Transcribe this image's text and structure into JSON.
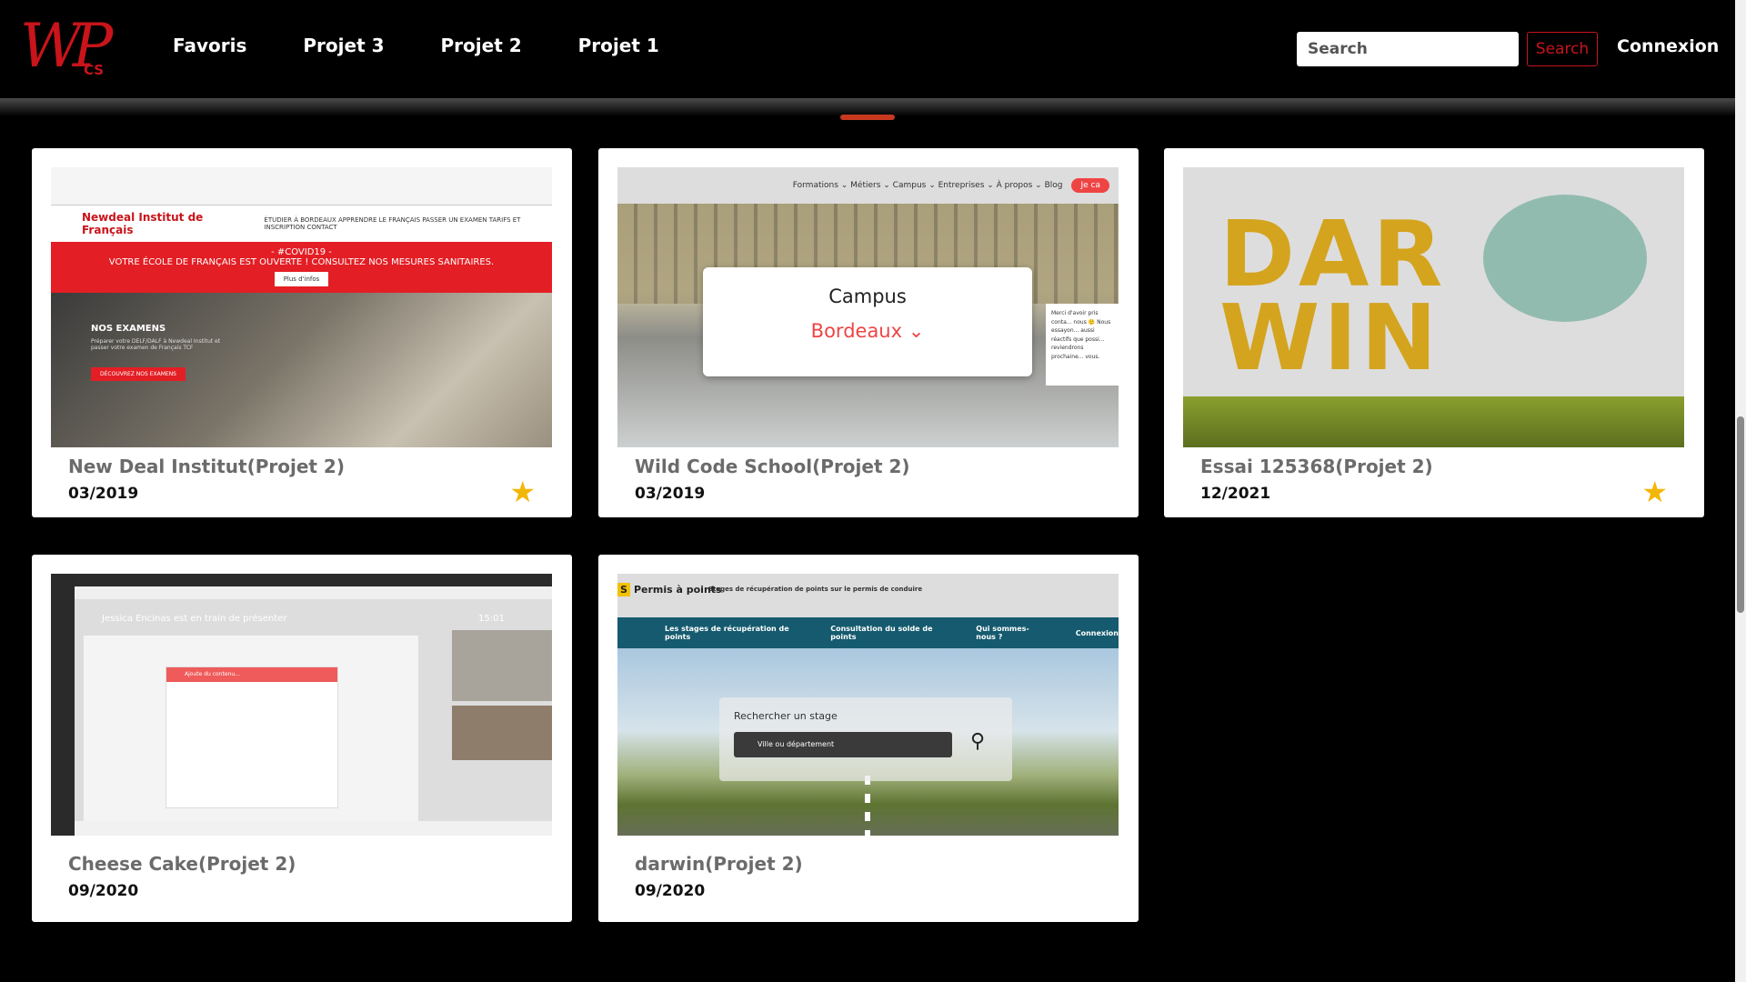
{
  "brand": {
    "logo_main": "WP",
    "logo_sub": "CS"
  },
  "nav": {
    "items": [
      "Favoris",
      "Projet 3",
      "Projet 2",
      "Projet 1"
    ]
  },
  "search": {
    "placeholder": "Search",
    "button_label": "Search"
  },
  "login_label": "Connexion",
  "colors": {
    "accent": "#c8141a",
    "star": "#f2b705",
    "card_bg": "#ffffff",
    "page_bg": "#000000"
  },
  "projects": [
    {
      "title": "New Deal Institut(Projet 2)",
      "date": "03/2019",
      "favorite": true,
      "thumb": {
        "brand": "Newdeal Institut de Français",
        "menu": "ÉTUDIER À BORDEAUX   APPRENDRE LE FRANÇAIS   PASSER UN EXAMEN   TARIFS ET INSCRIPTION   CONTACT",
        "banner_title": "- #COVID19 -",
        "banner_text": "VOTRE ÉCOLE DE FRANÇAIS EST OUVERTE ! CONSULTEZ NOS MESURES SANITAIRES.",
        "banner_button": "Plus d'infos",
        "section_title": "NOS EXAMENS",
        "section_text": "Préparer votre DELF/DALF à Newdeal Institut et passer votre examen de Français TCF",
        "section_button": "DÉCOUVREZ NOS EXAMENS"
      }
    },
    {
      "title": "Wild Code School(Projet 2)",
      "date": "03/2019",
      "favorite": false,
      "thumb": {
        "menu": "Formations ⌄   Métiers ⌄   Campus ⌄   Entreprises ⌄   À propos ⌄   Blog",
        "cta": "Je ca",
        "box_title": "Campus",
        "box_city": "Bordeaux ⌄",
        "chat": "Merci d'avoir pris conta... nous 🙂 Nous essayon... aussi réactifs que possi... reviendrons prochaine... vous."
      }
    },
    {
      "title": "Essai 125368(Projet 2)",
      "date": "12/2021",
      "favorite": true,
      "thumb": {
        "word": "DAR WIN"
      }
    },
    {
      "title": "Cheese Cake(Projet 2)",
      "date": "09/2020",
      "favorite": false,
      "thumb": {
        "presenting": "Jessica Encinas est en train de présenter",
        "time": "15:01",
        "slide_header": "Ajoute du contenu..."
      }
    },
    {
      "title": "darwin(Projet 2)",
      "date": "09/2020",
      "favorite": false,
      "thumb": {
        "logo_letter": "S",
        "logo_text": "Permis à points",
        "tagline": "Stages de récupération de points sur le permis de conduire",
        "nav": [
          "Les stages de récupération de points",
          "Consultation du solde de points",
          "Qui sommes-nous ?",
          "Connexion"
        ],
        "search_label": "Rechercher un stage",
        "search_placeholder": "Ville ou département"
      }
    }
  ]
}
